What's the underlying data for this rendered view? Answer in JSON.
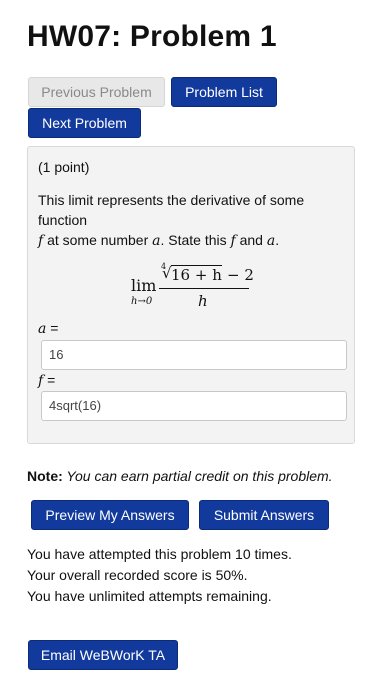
{
  "title": "HW07: Problem 1",
  "nav": {
    "previous_label": "Previous Problem",
    "list_label": "Problem List",
    "next_label": "Next Problem"
  },
  "problem": {
    "points": "(1 point)",
    "statement_line1": "This limit represents the derivative of some",
    "statement_line2": "function",
    "statement_f1": "f",
    "statement_mid1": " at some number ",
    "statement_a1": "a",
    "statement_mid2": ". State this ",
    "statement_f2": "f",
    "statement_mid3": " and ",
    "statement_a2": "a",
    "statement_end": ".",
    "formula": {
      "lim": "lim",
      "sub": "h→0",
      "root_index": "4",
      "radicand": "16 + h",
      "minus": "− 2",
      "denominator": "h"
    },
    "a_var": "a",
    "a_eq": " =",
    "a_value": "16",
    "f_var": "f",
    "f_eq": " =",
    "f_value": "4sqrt(16)"
  },
  "note": {
    "label": "Note:",
    "text": " You can earn partial credit on this problem."
  },
  "actions": {
    "preview_label": "Preview My Answers",
    "submit_label": "Submit Answers"
  },
  "status": {
    "line1": "You have attempted this problem 10 times.",
    "line2": "Your overall recorded score is 50%.",
    "line3": "You have unlimited attempts remaining."
  },
  "email_label": "Email WeBWorK TA",
  "colors": {
    "primary_button": "#123a9c",
    "disabled_button": "#e8e8e8",
    "panel_background": "#f3f3f3"
  }
}
